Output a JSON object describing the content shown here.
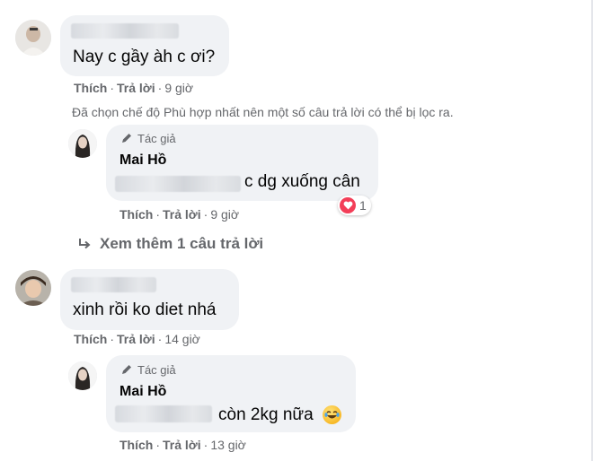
{
  "comments": [
    {
      "text": "Nay c gầy àh c ơi?",
      "actions": {
        "like": "Thích",
        "reply": "Trả lời",
        "time": "9 giờ"
      }
    },
    {
      "text": "xinh rồi ko diet nhá",
      "actions": {
        "like": "Thích",
        "reply": "Trả lời",
        "time": "14 giờ"
      }
    }
  ],
  "notice": "Đã chọn chế độ Phù hợp nhất nên một số câu trả lời có thể bị lọc ra.",
  "replies": [
    {
      "badge": "Tác giả",
      "name": "Mai Hồ",
      "text": "c dg xuống cân",
      "reaction_count": "1",
      "actions": {
        "like": "Thích",
        "reply": "Trả lời",
        "time": "9 giờ"
      }
    },
    {
      "badge": "Tác giả",
      "name": "Mai Hồ",
      "text": "còn 2kg nữa",
      "actions": {
        "like": "Thích",
        "reply": "Trả lời",
        "time": "13 giờ"
      }
    }
  ],
  "view_more": "Xem thêm 1 câu trả lời",
  "icons": {
    "pencil": "pencil-icon",
    "reply_arrow": "reply-arrow-icon",
    "heart": "heart-reaction-icon",
    "emoji": "laughing-emoji-icon"
  },
  "colors": {
    "bubble": "#f0f2f5",
    "secondary_text": "#65676b",
    "heart": "#f33e58"
  }
}
